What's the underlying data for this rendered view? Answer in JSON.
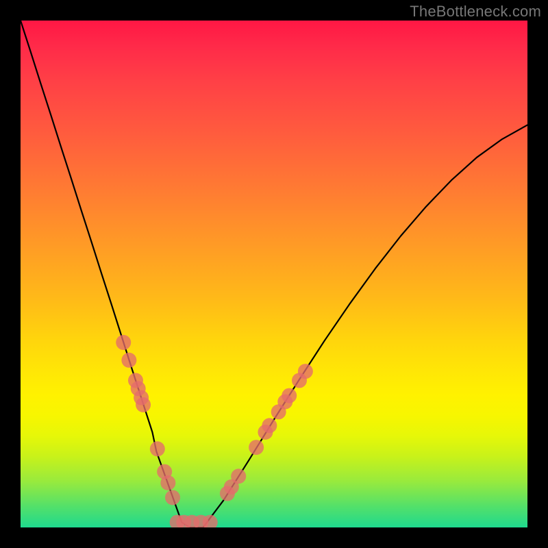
{
  "watermark": "TheBottleneck.com",
  "chart_data": {
    "type": "line",
    "title": "",
    "xlabel": "",
    "ylabel": "",
    "xlim": [
      0,
      100
    ],
    "ylim": [
      0,
      100
    ],
    "x": [
      0,
      2,
      4,
      6,
      8,
      10,
      12,
      14,
      16,
      18,
      20,
      22,
      24,
      26,
      26.8,
      27.8,
      28.8,
      29.8,
      30.8,
      31.8,
      33.4,
      36,
      40,
      45,
      50,
      55,
      60,
      65,
      70,
      75,
      80,
      85,
      90,
      95,
      100
    ],
    "y": [
      100,
      93.8,
      87.5,
      81.3,
      75.0,
      68.8,
      62.5,
      56.3,
      50.0,
      43.8,
      37.5,
      31.2,
      25.0,
      18.8,
      15.0,
      12.2,
      9.4,
      6.6,
      3.8,
      1.0,
      0.0,
      0.0,
      5.3,
      13.2,
      21.3,
      29.2,
      36.9,
      44.2,
      51.1,
      57.5,
      63.3,
      68.5,
      73.0,
      76.6,
      79.4
    ],
    "markers": [
      {
        "x": 20.3,
        "y": 36.5
      },
      {
        "x": 21.4,
        "y": 33.0
      },
      {
        "x": 22.7,
        "y": 29.0
      },
      {
        "x": 23.2,
        "y": 27.4
      },
      {
        "x": 23.8,
        "y": 25.6
      },
      {
        "x": 24.2,
        "y": 24.2
      },
      {
        "x": 27.0,
        "y": 15.5
      },
      {
        "x": 28.4,
        "y": 11.0
      },
      {
        "x": 29.1,
        "y": 8.8
      },
      {
        "x": 30.0,
        "y": 5.9
      },
      {
        "x": 30.9,
        "y": 1.0
      },
      {
        "x": 32.2,
        "y": 1.0
      },
      {
        "x": 33.8,
        "y": 1.0
      },
      {
        "x": 35.6,
        "y": 1.0
      },
      {
        "x": 37.4,
        "y": 1.0
      },
      {
        "x": 40.8,
        "y": 6.7
      },
      {
        "x": 41.6,
        "y": 8.0
      },
      {
        "x": 43.0,
        "y": 10.1
      },
      {
        "x": 46.5,
        "y": 15.8
      },
      {
        "x": 48.3,
        "y": 18.8
      },
      {
        "x": 49.1,
        "y": 20.1
      },
      {
        "x": 50.9,
        "y": 22.8
      },
      {
        "x": 52.2,
        "y": 24.8
      },
      {
        "x": 53.0,
        "y": 26.0
      },
      {
        "x": 55.0,
        "y": 29.0
      },
      {
        "x": 56.2,
        "y": 30.8
      }
    ],
    "marker_color": "#e46b6b",
    "background_gradient": {
      "top": "#ff1744",
      "upper_mid": "#ff7a33",
      "mid": "#ffd50c",
      "lower_mid": "#fff200",
      "bottom": "#1fd98e"
    }
  }
}
